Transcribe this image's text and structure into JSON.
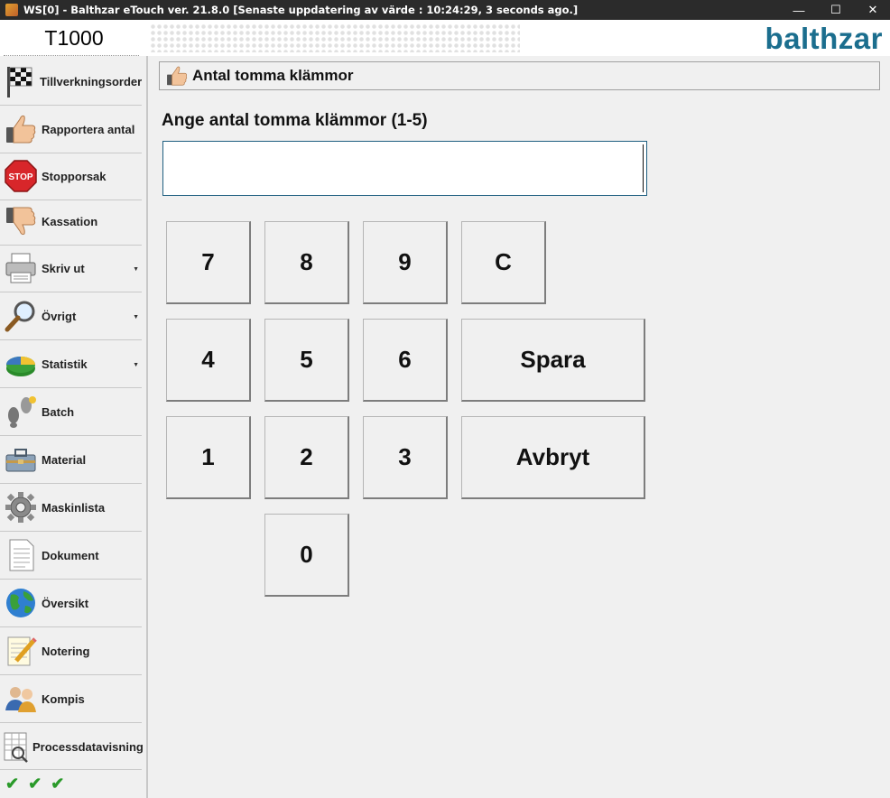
{
  "window": {
    "title": "WS[0] - Balthzar eTouch ver. 21.8.0  [Senaste uppdatering av värde : 10:24:29, 3 seconds ago.]",
    "minimize": "—",
    "maximize": "☐",
    "close": "✕"
  },
  "header": {
    "machine": "T1000",
    "logo": "balthzar"
  },
  "sidebar": {
    "items": [
      {
        "label": "Tillverkningsorder",
        "icon": "checkered-flag-icon"
      },
      {
        "label": "Rapportera antal",
        "icon": "thumbs-up-icon"
      },
      {
        "label": "Stopporsak",
        "icon": "stop-sign-icon"
      },
      {
        "label": "Kassation",
        "icon": "thumbs-down-icon"
      },
      {
        "label": "Skriv ut",
        "icon": "printer-icon"
      },
      {
        "label": "Övrigt",
        "icon": "magnifier-icon"
      },
      {
        "label": "Statistik",
        "icon": "pie-chart-icon"
      },
      {
        "label": "Batch",
        "icon": "footprints-icon"
      },
      {
        "label": "Material",
        "icon": "toolbox-icon"
      },
      {
        "label": "Maskinlista",
        "icon": "gear-icon"
      },
      {
        "label": "Dokument",
        "icon": "document-icon"
      },
      {
        "label": "Översikt",
        "icon": "globe-icon"
      },
      {
        "label": "Notering",
        "icon": "notepad-pencil-icon"
      },
      {
        "label": "Kompis",
        "icon": "users-icon"
      },
      {
        "label": "Processdatavisning",
        "icon": "table-magnifier-icon"
      }
    ],
    "status_checks": [
      "✔",
      "✔",
      "✔"
    ]
  },
  "main": {
    "panel_title": "Antal tomma klämmor",
    "prompt": "Ange antal tomma klämmor (1-5)",
    "input_value": "",
    "keys": {
      "k7": "7",
      "k8": "8",
      "k9": "9",
      "clear": "C",
      "k4": "4",
      "k5": "5",
      "k6": "6",
      "save": "Spara",
      "k1": "1",
      "k2": "2",
      "k3": "3",
      "cancel": "Avbryt",
      "k0": "0"
    }
  },
  "colors": {
    "logo": "#1b6e8e",
    "titlebar": "#2b2b2b",
    "input_border": "#1f5f80",
    "check": "#2a9a2a"
  }
}
